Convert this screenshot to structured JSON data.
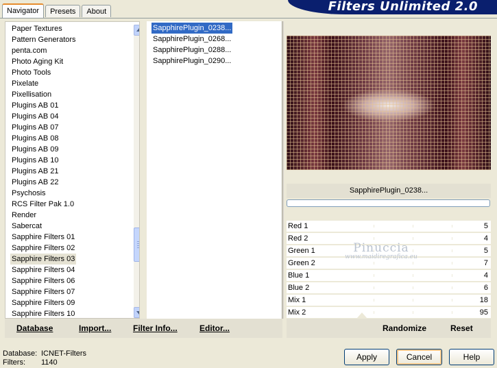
{
  "header": {
    "tabs": [
      "Navigator",
      "Presets",
      "About"
    ],
    "active_tab": "Navigator",
    "brand": "Filters Unlimited 2.0"
  },
  "categories": {
    "items": [
      "Paper Textures",
      "Pattern Generators",
      "penta.com",
      "Photo Aging Kit",
      "Photo Tools",
      "Pixelate",
      "Pixellisation",
      "Plugins AB 01",
      "Plugins AB 04",
      "Plugins AB 07",
      "Plugins AB 08",
      "Plugins AB 09",
      "Plugins AB 10",
      "Plugins AB 21",
      "Plugins AB 22",
      "Psychosis",
      "RCS Filter Pak 1.0",
      "Render",
      "Sabercat",
      "Sapphire Filters 01",
      "Sapphire Filters 02",
      "Sapphire Filters 03",
      "Sapphire Filters 04",
      "Sapphire Filters 06",
      "Sapphire Filters 07",
      "Sapphire Filters 09",
      "Sapphire Filters 10"
    ],
    "selected": "Sapphire Filters 03"
  },
  "filters": {
    "items": [
      "SapphirePlugin_0238...",
      "SapphirePlugin_0268...",
      "SapphirePlugin_0288...",
      "SapphirePlugin_0290..."
    ],
    "selected": "SapphirePlugin_0238..."
  },
  "preview": {
    "filter_name": "SapphirePlugin_0238..."
  },
  "params": [
    {
      "name": "Red 1",
      "value": "5"
    },
    {
      "name": "Red 2",
      "value": "4"
    },
    {
      "name": "Green 1",
      "value": "5"
    },
    {
      "name": "Green 2",
      "value": "7"
    },
    {
      "name": "Blue 1",
      "value": "4"
    },
    {
      "name": "Blue 2",
      "value": "6"
    },
    {
      "name": "Mix 1",
      "value": "18"
    },
    {
      "name": "Mix 2",
      "value": "95"
    }
  ],
  "watermark": {
    "line1": "Pinuccia",
    "line2": "www.maidiregrafica.eu"
  },
  "toolbar": {
    "database": "Database",
    "import": "Import...",
    "filter_info": "Filter Info...",
    "editor": "Editor...",
    "randomize": "Randomize",
    "reset": "Reset"
  },
  "status": {
    "database_label": "Database:",
    "database_value": "ICNET-Filters",
    "filters_label": "Filters:",
    "filters_value": "1140"
  },
  "buttons": {
    "apply": "Apply",
    "cancel": "Cancel",
    "help": "Help"
  },
  "colors": {
    "dialog_bg": "#ece9d8",
    "brand_bg": "#0a1f6e",
    "selection": "#316ac5"
  }
}
